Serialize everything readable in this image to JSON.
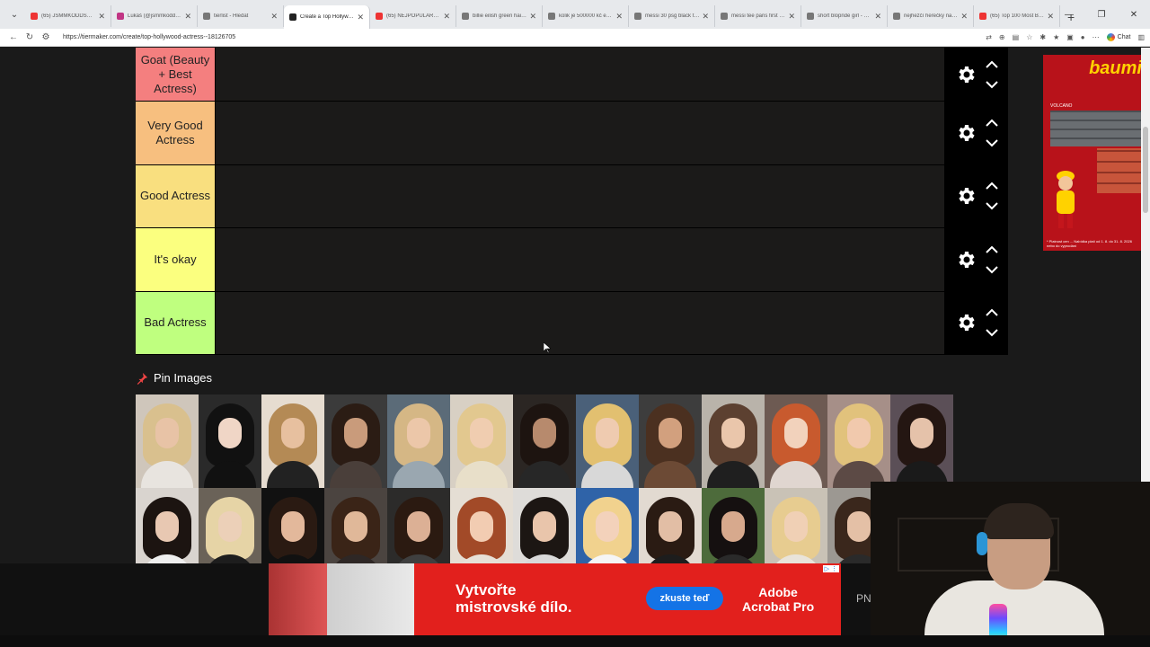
{
  "browser": {
    "tabs": [
      {
        "label": "(65) JSMMKODDSHOTS -",
        "fav": "#e33",
        "active": false
      },
      {
        "label": "Lukáš (@jsmmkoddshots",
        "fav": "#c13584",
        "active": false
      },
      {
        "label": "tierlist - Hledat",
        "fav": "#777",
        "active": false
      },
      {
        "label": "Create a Top Hollywood",
        "fav": "#222",
        "active": true
      },
      {
        "label": "(65) NEJPOPULÁRNĚJŠÍ",
        "fav": "#e33",
        "active": false
      },
      {
        "label": "billie eilish green hair - H",
        "fav": "#777",
        "active": false
      },
      {
        "label": "kolik je 500000 kč eur - H",
        "fav": "#777",
        "active": false
      },
      {
        "label": "messi 30 psg black tee",
        "fav": "#777",
        "active": false
      },
      {
        "label": "messi tee paris first day",
        "fav": "#777",
        "active": false
      },
      {
        "label": "short blopnde girl - Hleda",
        "fav": "#777",
        "active": false
      },
      {
        "label": "nejhezčí herečky na světě",
        "fav": "#777",
        "active": false
      },
      {
        "label": "(65) Top 100 Most Beaut",
        "fav": "#e33",
        "active": false
      }
    ],
    "url": "https://tiermaker.com/create/top-hollywood-actress--18126705",
    "chat_label": "Chat"
  },
  "tiers": [
    {
      "label": "Goat (Beauty + Best Actress)",
      "color": "#f47f7f"
    },
    {
      "label": "Very Good Actress",
      "color": "#f7bf7f"
    },
    {
      "label": "Good Actress",
      "color": "#f9df7f"
    },
    {
      "label": "It's okay",
      "color": "#fbff7f"
    },
    {
      "label": "Bad Actress",
      "color": "#bfff7f"
    }
  ],
  "pin_images_label": "Pin Images",
  "image_tiles": [
    {
      "bg": "#cfc6bb",
      "hair": "#d9c08e",
      "skin": "#e8c3a6",
      "body": "#e8e4df"
    },
    {
      "bg": "#2a2a2a",
      "hair": "#111111",
      "skin": "#f0d6c6",
      "body": "#111111"
    },
    {
      "bg": "#e6dcd0",
      "hair": "#b48a55",
      "skin": "#e7c09f",
      "body": "#222222"
    },
    {
      "bg": "#3b3b3b",
      "hair": "#2b1c14",
      "skin": "#c99b7b",
      "body": "#4a3f3a"
    },
    {
      "bg": "#5b6b78",
      "hair": "#d5b785",
      "skin": "#ecc7a9",
      "body": "#9aa7b0"
    },
    {
      "bg": "#d8d0c4",
      "hair": "#e2c88f",
      "skin": "#f0cdb0",
      "body": "#e8dfc9"
    },
    {
      "bg": "#2b2623",
      "hair": "#1d1410",
      "skin": "#b78a6d",
      "body": "#272727"
    },
    {
      "bg": "#4a6079",
      "hair": "#e2c070",
      "skin": "#efcbb0",
      "body": "#d8d8d8"
    },
    {
      "bg": "#3d3d3d",
      "hair": "#4b3020",
      "skin": "#d2a07e",
      "body": "#6c4a35"
    },
    {
      "bg": "#b9b3aa",
      "hair": "#5c4030",
      "skin": "#eac6ab",
      "body": "#1f1f1f"
    },
    {
      "bg": "#6d5a52",
      "hair": "#c85a2e",
      "skin": "#f2d2bc",
      "body": "#e0d6d0"
    },
    {
      "bg": "#a68f88",
      "hair": "#e1c27c",
      "skin": "#f1c9ad",
      "body": "#5c4a45"
    },
    {
      "bg": "#5b4f57",
      "hair": "#241612",
      "skin": "#e5c2aa",
      "body": "#1a1a1a"
    },
    {
      "bg": "#d9d4cf",
      "hair": "#1c1411",
      "skin": "#e8c8b2",
      "body": "#efefef"
    },
    {
      "bg": "#6a6258",
      "hair": "#e6d4a6",
      "skin": "#ecd0b8",
      "body": "#1d1d1d"
    },
    {
      "bg": "#111111",
      "hair": "#2a1a12",
      "skin": "#e3b89b",
      "body": "#111111"
    },
    {
      "bg": "#4b4440",
      "hair": "#3a2417",
      "skin": "#e0b899",
      "body": "#2e2725"
    },
    {
      "bg": "#2c2b2a",
      "hair": "#2b1a11",
      "skin": "#dcb095",
      "body": "#3f3f3f"
    },
    {
      "bg": "#e5ded4",
      "hair": "#a24a28",
      "skin": "#f2ccb2",
      "body": "#e7e0d7"
    },
    {
      "bg": "#dedcd9",
      "hair": "#1c1613",
      "skin": "#e9c5ab",
      "body": "#d9d9d9"
    },
    {
      "bg": "#2f63a8",
      "hair": "#f1d28e",
      "skin": "#f3d2bb",
      "body": "#f5f5f5"
    },
    {
      "bg": "#e2dad1",
      "hair": "#2a1b13",
      "skin": "#e2bea5",
      "body": "#1d1d1d"
    },
    {
      "bg": "#4d6b3b",
      "hair": "#151010",
      "skin": "#d7a98d",
      "body": "#2a2a2a"
    },
    {
      "bg": "#c9c2b6",
      "hair": "#e7cc90",
      "skin": "#f0d0b5",
      "body": "#e9e4da"
    },
    {
      "bg": "#9c9892",
      "hair": "#3a271c",
      "skin": "#e4c0a6",
      "body": "#2a2a2a"
    }
  ],
  "ads": {
    "right_brand": "baumi",
    "right_sub": "VOLCANO",
    "right_fine": "* Platnost cen ... Nabídka platí od 1. 8. do 31. 8. 2026 nebo do vyprodání",
    "bottom_headline_1": "Vytvořte",
    "bottom_headline_2": "mistrovské dílo.",
    "bottom_cta": "zkuste teď",
    "bottom_brand_1": "Adobe",
    "bottom_brand_2": "Acrobat Pro",
    "adchoices": "▷ ⋮",
    "overflow_text": "PN"
  }
}
